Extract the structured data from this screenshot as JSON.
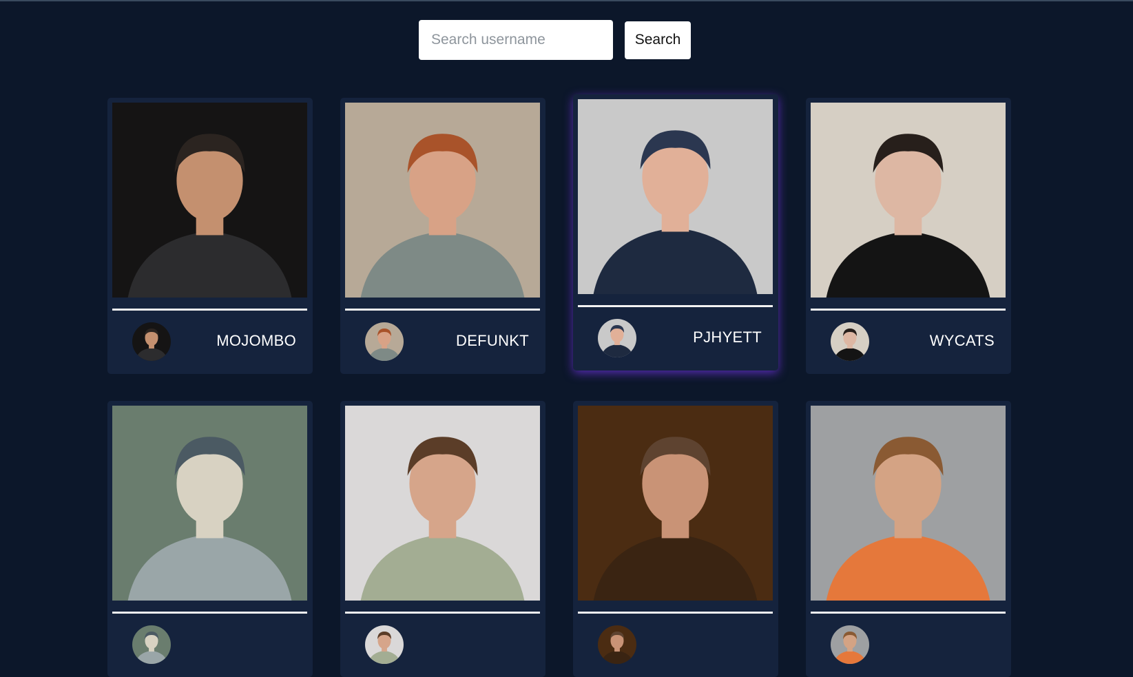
{
  "search": {
    "placeholder": "Search username",
    "button_label": "Search"
  },
  "users": [
    {
      "username": "MOJOMBO",
      "avatar_icon": "user-avatar-mojombo",
      "bg": "#151414",
      "skin": "#c4906f",
      "hair": "#2b2420",
      "shirt": "#2c2c2e"
    },
    {
      "username": "DEFUNKT",
      "avatar_icon": "user-avatar-defunkt",
      "bg": "#b7a997",
      "skin": "#d8a286",
      "hair": "#a9532a",
      "shirt": "#7e8a86"
    },
    {
      "username": "PJHYETT",
      "avatar_icon": "user-avatar-pjhyett",
      "bg": "#c9c9c9",
      "skin": "#e1b098",
      "hair": "#2b3750",
      "shirt": "#1e2a40"
    },
    {
      "username": "WYCATS",
      "avatar_icon": "user-avatar-wycats",
      "bg": "#d6cfc4",
      "skin": "#ddb7a3",
      "hair": "#271f1b",
      "shirt": "#141414"
    },
    {
      "username": "",
      "avatar_icon": "user-avatar-5",
      "bg": "#6a7d6e",
      "skin": "#d8d2c2",
      "hair": "#4b5a63",
      "shirt": "#9aa6a8"
    },
    {
      "username": "",
      "avatar_icon": "user-avatar-6",
      "bg": "#dad8d8",
      "skin": "#d6a58a",
      "hair": "#5b3d28",
      "shirt": "#a3ad93"
    },
    {
      "username": "",
      "avatar_icon": "user-avatar-7",
      "bg": "#4b2c12",
      "skin": "#c99376",
      "hair": "#5e4330",
      "shirt": "#3a2412"
    },
    {
      "username": "",
      "avatar_icon": "user-avatar-8",
      "bg": "#9ea0a2",
      "skin": "#d4a384",
      "hair": "#8a5a33",
      "shirt": "#e5783b"
    }
  ]
}
